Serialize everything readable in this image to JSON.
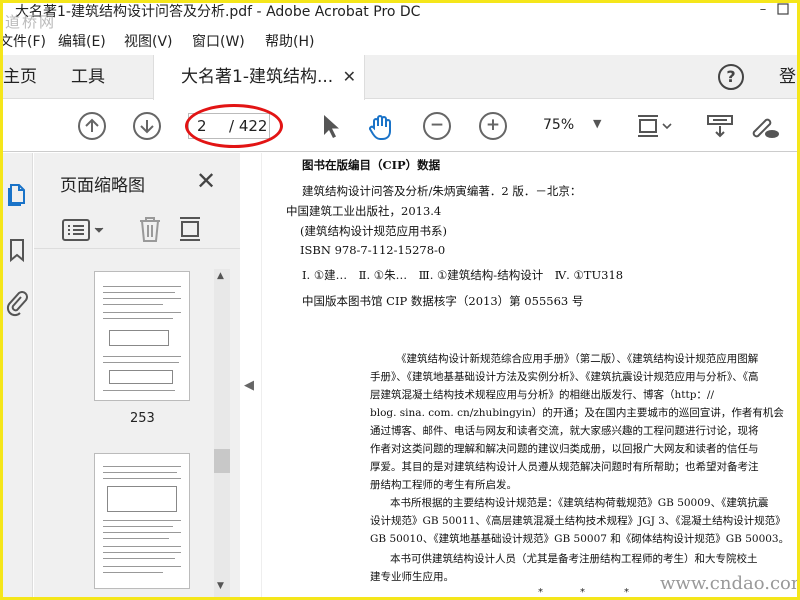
{
  "window": {
    "title": "大名著1-建筑结构设计问答及分析.pdf - Adobe Acrobat Pro DC"
  },
  "watermark_top": "道桥网",
  "menu": [
    "文件(F)",
    "编辑(E)",
    "视图(V)",
    "窗口(W)",
    "帮助(H)"
  ],
  "tabs": {
    "home": "主页",
    "tools": "工具",
    "document": "大名著1-建筑结构...",
    "close": "✕",
    "help": "?",
    "login": "登"
  },
  "toolbar": {
    "current_page": "2",
    "total_pages": "/ 422",
    "zoom": "75%"
  },
  "thumbnails": {
    "title": "页面缩略图",
    "close": "✕",
    "page_label": "253"
  },
  "document": {
    "cip_lines": [
      "图书在版编目（CIP）数据",
      "建筑结构设计问答及分析/朱炳寅编著．2 版．－北京：",
      "中国建筑工业出版社，2013.4",
      "(建筑结构设计规范应用书系)",
      "ISBN 978-7-112-15278-0",
      "Ⅰ. ①建…　Ⅱ. ①朱…　Ⅲ. ①建筑结构-结构设计　Ⅳ. ①TU318",
      "中国版本图书馆 CIP 数据核字（2013）第 055563 号"
    ],
    "para_lines": [
      "《建筑结构设计新规范综合应用手册》（第二版）、《建筑结构设计规范应用图解",
      "手册》、《建筑地基基础设计方法及实例分析》、《建筑抗震设计规范应用与分析》、《高",
      "层建筑混凝土结构技术规程应用与分析》的相继出版发行、博客（http：//",
      "blog. sina. com. cn/zhubingyin）的开通；及在国内主要城市的巡回宣讲，作者有机会",
      "通过博客、邮件、电话与网友和读者交流，就大家感兴趣的工程问题进行讨论，现将",
      "作者对这类问题的理解和解决问题的建议归类成册，以回报广大网友和读者的信任与",
      "厚爱。其目的是对建筑结构设计人员遵从规范解决问题时有所帮助；也希望对备考注",
      "册结构工程师的考生有所启发。",
      "本书所根据的主要结构设计规范是：《建筑结构荷载规范》GB 50009、《建筑抗震",
      "设计规范》GB 50011、《高层建筑混凝土结构技术规程》JGJ 3、《混凝土结构设计规范》",
      "GB 50010、《建筑地基基础设计规范》GB 50007 和《砌体结构设计规范》GB 50003。",
      "本书可供建筑结构设计人员（尤其是备考注册结构工程师的考生）和大专院校土",
      "建专业师生应用。"
    ],
    "stars": [
      "*",
      "*",
      "*"
    ],
    "watermark": "www.cndao.com"
  }
}
